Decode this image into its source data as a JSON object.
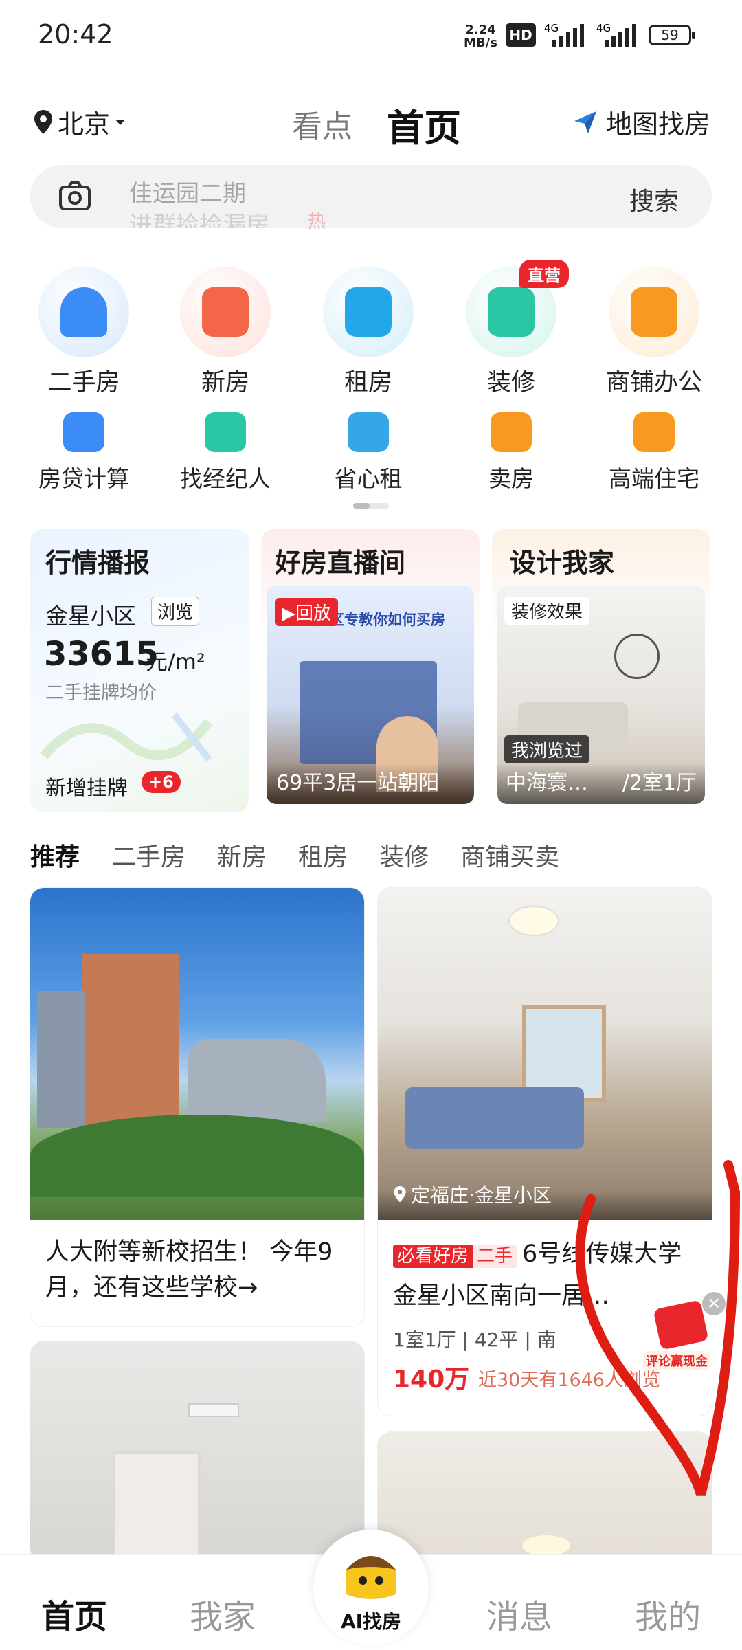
{
  "status_bar": {
    "time": "20:42",
    "net_speed": "2.24",
    "net_unit": "MB/s",
    "hd": "HD",
    "sig1": "4G",
    "sig2": "4G",
    "battery": "59"
  },
  "header": {
    "location": "北京",
    "tab_kandian": "看点",
    "tab_home": "首页",
    "map_find": "地图找房"
  },
  "search": {
    "line1": "佳运园二期",
    "line2": "进群捡捡漏房",
    "hot": "热",
    "button": "搜索"
  },
  "main_icons": [
    {
      "label": "二手房",
      "icon": "house-icon",
      "color": "#3b8cf6"
    },
    {
      "label": "新房",
      "icon": "building-icon",
      "color": "#f4664a"
    },
    {
      "label": "租房",
      "icon": "sofa-icon",
      "color": "#22a8e8"
    },
    {
      "label": "装修",
      "icon": "armchair-icon",
      "color": "#2bc6a4",
      "badge": "直营"
    },
    {
      "label": "商铺办公",
      "icon": "shop-icon",
      "color": "#f79a1f"
    }
  ],
  "sub_icons": [
    {
      "label": "房贷计算",
      "icon": "calculator-icon",
      "color": "#3b8cf6"
    },
    {
      "label": "找经纪人",
      "icon": "agent-tie-icon",
      "color": "#2bc6a4"
    },
    {
      "label": "省心租",
      "icon": "check-folder-icon",
      "color": "#35a6e6"
    },
    {
      "label": "卖房",
      "icon": "tag-icon",
      "color": "#f79a1f"
    },
    {
      "label": "高端住宅",
      "icon": "crown-box-icon",
      "color": "#f79a1f"
    }
  ],
  "cards": {
    "market": {
      "title": "行情播报",
      "community": "金星小区",
      "browse": "浏览",
      "price": "33615",
      "unit": "元/m²",
      "price_desc": "二手挂牌均价",
      "new_listing": "新增挂牌",
      "new_count": "+6"
    },
    "live": {
      "title": "好房直播间",
      "replay": "回放",
      "banner": "东城区专教你如何买房",
      "caption": "69平3居一站朝阳"
    },
    "design": {
      "title": "设计我家",
      "tag": "装修效果",
      "viewed": "我浏览过",
      "caption": "中海寰…",
      "caption2": "/2室1厅"
    }
  },
  "category_tabs": [
    "推荐",
    "二手房",
    "新房",
    "租房",
    "装修",
    "商铺买卖"
  ],
  "feed": {
    "left_caption": "人大附等新校招生！ 今年9月，还有这些学校→",
    "right_location": "定福庄·金星小区",
    "right_tag1": "必看好房",
    "right_tag2": "二手",
    "right_title": "6号线传媒大学 金星小区南向一居…",
    "right_specs": "1室1厅 | 42平 | 南",
    "right_price": "140万",
    "right_views": "近30天有1646人浏览",
    "promo": "评论赢现金"
  },
  "bottom_nav": {
    "home": "首页",
    "myhome": "我家",
    "ai": "AI找房",
    "messages": "消息",
    "mine": "我的"
  }
}
